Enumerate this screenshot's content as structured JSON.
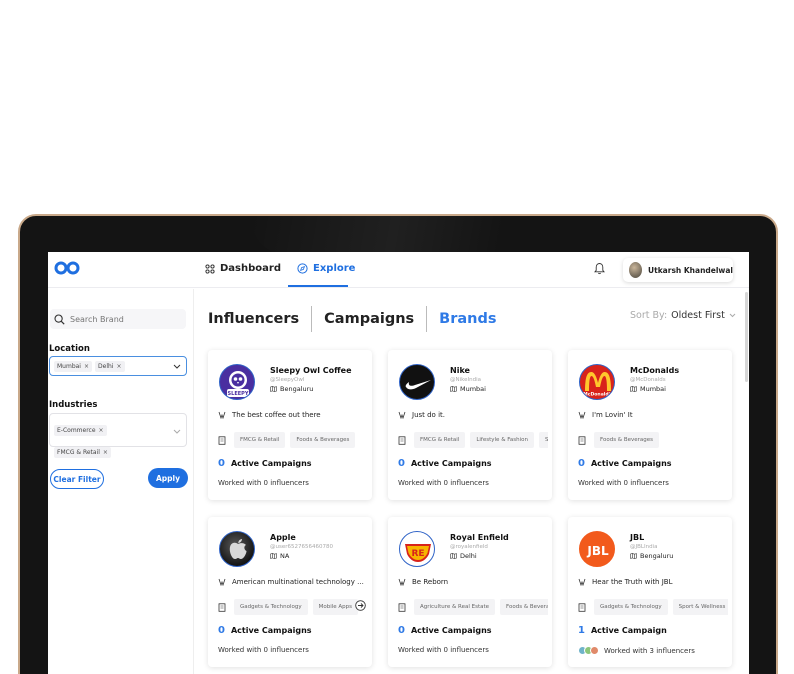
{
  "topnav": {
    "dashboard_label": "Dashboard",
    "explore_label": "Explore",
    "user_name": "Utkarsh Khandelwal"
  },
  "sidebar": {
    "search_placeholder": "Search Brand",
    "location_title": "Location",
    "location_chips": [
      "Mumbai",
      "Delhi"
    ],
    "industries_title": "Industries",
    "industry_chips": [
      "E-Commerce",
      "FMCG & Retail"
    ],
    "clear_filter_label": "Clear Filter",
    "apply_label": "Apply"
  },
  "tabs": [
    "Influencers",
    "Campaigns",
    "Brands"
  ],
  "active_tab": "Brands",
  "sort": {
    "label": "Sort By:",
    "value": "Oldest First"
  },
  "colors": {
    "accent": "#1f6fe0",
    "brand_tab": "#2f7ae6"
  },
  "cards": [
    {
      "name": "Sleepy Owl Coffee",
      "handle": "@SleepyOwl",
      "city": "Bengaluru",
      "tagline": "The best coffee out there",
      "tags": [
        "FMCG & Retail",
        "Foods & Beverages"
      ],
      "campaign_count": "0",
      "campaign_label": "Active Campaigns",
      "worked": "Worked with 0 influencers",
      "logo": "sleepy-owl-logo"
    },
    {
      "name": "Nike",
      "handle": "@NikeIndia",
      "city": "Mumbai",
      "tagline": "Just do it.",
      "tags": [
        "FMCG & Retail",
        "Lifestyle & Fashion",
        "Sp"
      ],
      "campaign_count": "0",
      "campaign_label": "Active Campaigns",
      "worked": "Worked with 0 influencers",
      "logo": "nike-logo"
    },
    {
      "name": "McDonalds",
      "handle": "@McDonalds",
      "city": "Mumbai",
      "tagline": "I'm Lovin' It",
      "tags": [
        "Foods & Beverages"
      ],
      "campaign_count": "0",
      "campaign_label": "Active Campaigns",
      "worked": "Worked with 0 influencers",
      "logo": "mcdonalds-logo"
    },
    {
      "name": "Apple",
      "handle": "@user6527656460780",
      "city": "NA",
      "tagline": "American multinational technology ...",
      "tags": [
        "Gadgets & Technology",
        "Mobile Apps"
      ],
      "campaign_count": "0",
      "campaign_label": "Active Campaigns",
      "worked": "Worked with 0 influencers",
      "logo": "apple-logo"
    },
    {
      "name": "Royal Enfield",
      "handle": "@royalenfield",
      "city": "Delhi",
      "tagline": "Be Reborn",
      "tags": [
        "Agriculture & Real Estate",
        "Foods & Bevera"
      ],
      "campaign_count": "0",
      "campaign_label": "Active Campaigns",
      "worked": "Worked with 0 influencers",
      "logo": "royal-enfield-logo"
    },
    {
      "name": "JBL",
      "handle": "@JBLIndia",
      "city": "Bengaluru",
      "tagline": "Hear the Truth with JBL",
      "tags": [
        "Gadgets & Technology",
        "Sport & Wellness"
      ],
      "campaign_count": "1",
      "campaign_label": "Active Campaign",
      "worked": "Worked with 3 influencers",
      "logo": "jbl-logo"
    }
  ]
}
